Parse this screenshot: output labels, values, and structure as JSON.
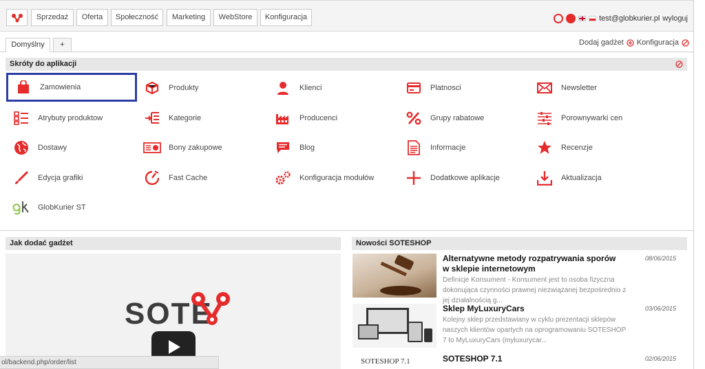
{
  "nav": {
    "items": [
      "Sprzedaż",
      "Oferta",
      "Społeczność",
      "Marketing",
      "WebStore",
      "Konfiguracja"
    ],
    "user_email": "test@globkurier.pl",
    "logout": "wyloguj"
  },
  "tabs": {
    "items": [
      "Domyślny",
      "+"
    ],
    "add_gadget": "Dodaj gadżet",
    "config": "Konfiguracja"
  },
  "shortcuts": {
    "title": "Skróty do aplikacji",
    "items": [
      {
        "label": "Zamowienia",
        "icon": "bag-icon"
      },
      {
        "label": "Produkty",
        "icon": "box-icon"
      },
      {
        "label": "Klienci",
        "icon": "person-icon"
      },
      {
        "label": "Platnosci",
        "icon": "card-icon"
      },
      {
        "label": "Newsletter",
        "icon": "envelope-icon"
      },
      {
        "label": "Atrybuty produktow",
        "icon": "checklist-icon"
      },
      {
        "label": "Kategorie",
        "icon": "tree-icon"
      },
      {
        "label": "Producenci",
        "icon": "factory-icon"
      },
      {
        "label": "Grupy rabatowe",
        "icon": "percent-icon"
      },
      {
        "label": "Porownywarki cen",
        "icon": "sliders-icon"
      },
      {
        "label": "Dostawy",
        "icon": "globe-icon"
      },
      {
        "label": "Bony zakupowe",
        "icon": "voucher-icon"
      },
      {
        "label": "Blog",
        "icon": "chat-icon"
      },
      {
        "label": "Informacje",
        "icon": "document-icon"
      },
      {
        "label": "Recenzje",
        "icon": "star-icon"
      },
      {
        "label": "Edycja grafiki",
        "icon": "brush-icon"
      },
      {
        "label": "Fast Cache",
        "icon": "stopwatch-icon"
      },
      {
        "label": "Konfiguracja modułów",
        "icon": "gears-icon"
      },
      {
        "label": "Dodatkowe aplikacje",
        "icon": "plus-icon"
      },
      {
        "label": "Aktualizacja",
        "icon": "download-icon"
      },
      {
        "label": "GlobKurier ST",
        "icon": "gk-logo-icon"
      }
    ]
  },
  "howto": {
    "title": "Jak dodać gadżet",
    "video_logo": "SOTE"
  },
  "news": {
    "title": "Nowości SOTESHOP",
    "items": [
      {
        "title": "Alternatywne metody rozpatrywania sporów w sklepie internetowym",
        "date": "08/06/2015",
        "excerpt": "Definicje Konsument - Konsument jest to osoba fizyczna dokonująca czynności prawnej niezwiązanej bezpośrednio z jej działalnością g..."
      },
      {
        "title": "Sklep MyLuxuryCars",
        "date": "03/06/2015",
        "excerpt": "Kolejny sklep przedstawiany w cyklu prezentacji sklepów naszych klientów opartych na oprogramowaniu SOTESHOP 7 to MyLuxuryCars (myluxurycar..."
      },
      {
        "title": "SOTESHOP 7.1",
        "date": "02/06/2015",
        "excerpt": "",
        "thumb_text": "SOTESHOP 7.1"
      }
    ]
  },
  "status_url": "ol/backend.php/order/list",
  "colors": {
    "accent": "#e52b2b",
    "selected_border": "#2b3da3"
  }
}
